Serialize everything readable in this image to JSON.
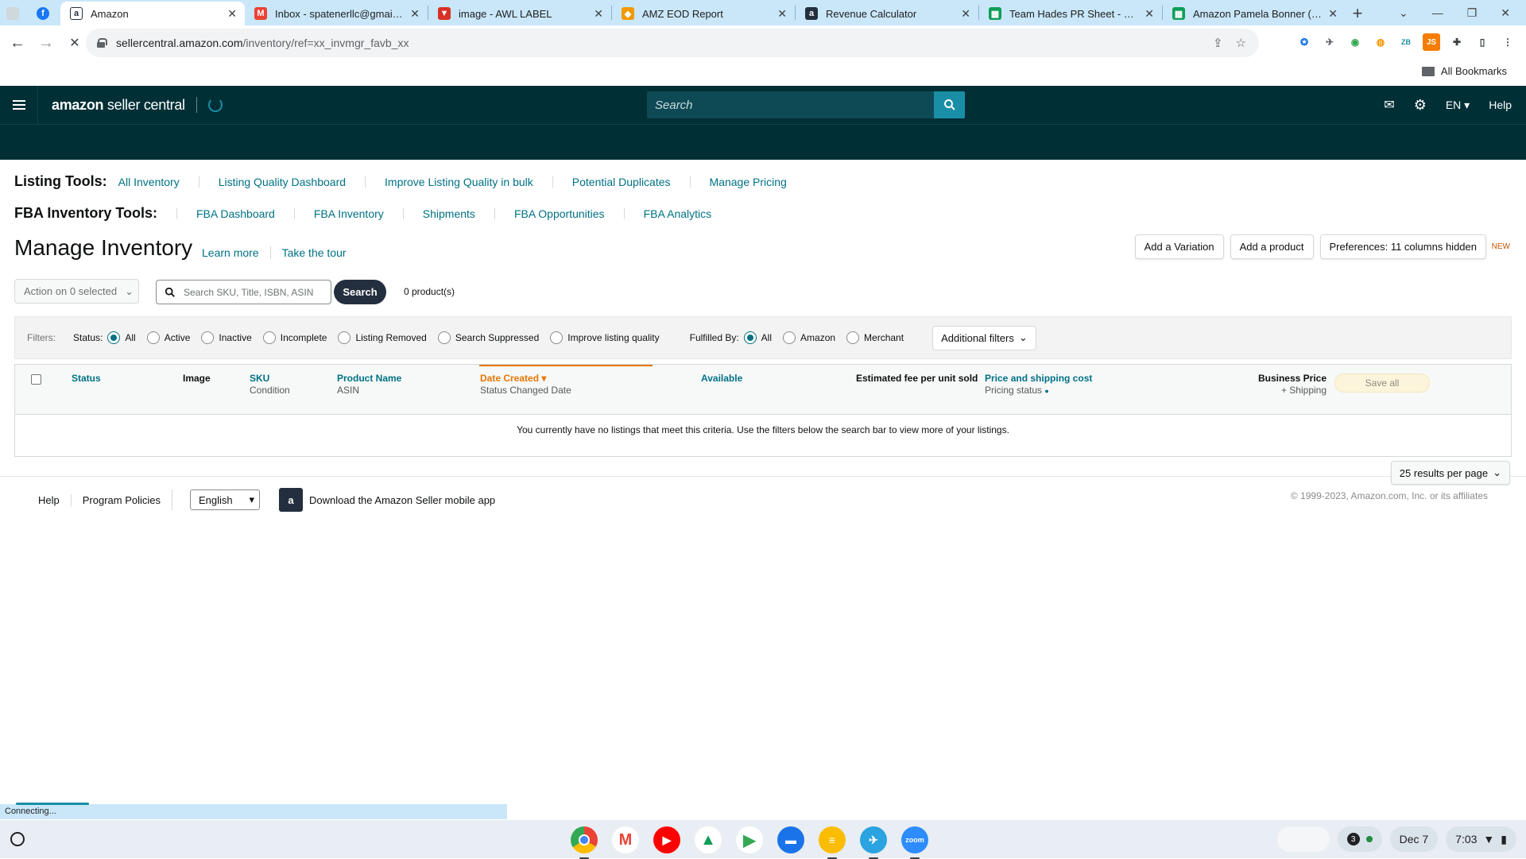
{
  "browser": {
    "tabs": [
      {
        "label": "",
        "icon": "sheets-icon",
        "color": "#cfd8dc"
      },
      {
        "label": "",
        "icon": "facebook-icon",
        "color": "#1877f2"
      },
      {
        "label": "Amazon",
        "icon": "amazon-icon",
        "color": "#232f3e",
        "active": true
      },
      {
        "label": "Inbox - spatenerllc@gmail.com",
        "icon": "gmail-icon",
        "color": "#ea4335"
      },
      {
        "label": "image - AWL LABEL",
        "icon": "label-icon",
        "color": "#d93025"
      },
      {
        "label": "AMZ EOD Report",
        "icon": "report-icon",
        "color": "#f29900"
      },
      {
        "label": "Revenue Calculator",
        "icon": "amazon-icon",
        "color": "#232f3e"
      },
      {
        "label": "Team Hades PR Sheet - Google",
        "icon": "sheets-icon",
        "color": "#0f9d58"
      },
      {
        "label": "Amazon Pamela Bonner (Dr B",
        "icon": "sheets-icon",
        "color": "#0f9d58"
      }
    ],
    "url_host": "sellercentral.amazon.com",
    "url_path": "/inventory/ref=xx_invmgr_favb_xx",
    "bookmarks_label": "All Bookmarks",
    "status_text": "Connecting..."
  },
  "header": {
    "logo_bold": "amazon",
    "logo_rest": " seller central",
    "search_placeholder": "Search",
    "lang": "EN",
    "help": "Help"
  },
  "listing_tools": {
    "label": "Listing Tools:",
    "links": [
      "All Inventory",
      "Listing Quality Dashboard",
      "Improve Listing Quality in bulk",
      "Potential Duplicates",
      "Manage Pricing"
    ]
  },
  "fba_tools": {
    "label": "FBA Inventory Tools:",
    "links": [
      "FBA Dashboard",
      "FBA Inventory",
      "Shipments",
      "FBA Opportunities",
      "FBA Analytics"
    ]
  },
  "page": {
    "title": "Manage Inventory",
    "learn_more": "Learn more",
    "take_tour": "Take the tour",
    "add_variation": "Add a Variation",
    "add_product": "Add a product",
    "preferences": "Preferences: 11 columns hidden",
    "new_badge": "NEW",
    "action_select": "Action on 0 selected",
    "search_placeholder": "Search SKU, Title, ISBN, ASIN",
    "search_button": "Search",
    "product_count": "0 product(s)"
  },
  "filters": {
    "label": "Filters:",
    "status_label": "Status:",
    "status_options": [
      "All",
      "Active",
      "Inactive",
      "Incomplete",
      "Listing Removed",
      "Search Suppressed",
      "Improve listing quality"
    ],
    "status_selected": "All",
    "fulfilled_label": "Fulfilled By:",
    "fulfilled_options": [
      "All",
      "Amazon",
      "Merchant"
    ],
    "fulfilled_selected": "All",
    "additional": "Additional filters"
  },
  "table": {
    "col_status": "Status",
    "col_image": "Image",
    "col_sku": "SKU",
    "col_condition": "Condition",
    "col_product_name": "Product Name",
    "col_asin": "ASIN",
    "col_date_created": "Date Created",
    "col_status_changed": "Status Changed Date",
    "col_available": "Available",
    "col_est_fee": "Estimated fee per unit sold",
    "col_price": "Price and shipping cost",
    "col_pricing_status": "Pricing status",
    "col_business_price": "Business Price",
    "col_plus_shipping": "+ Shipping",
    "save_all": "Save all",
    "empty_message": "You currently have no listings that meet this criteria. Use the filters below the search bar to view more of your listings.",
    "per_page": "25 results per page"
  },
  "footer": {
    "help": "Help",
    "policies": "Program Policies",
    "language": "English",
    "download_app": "Download the Amazon Seller mobile app",
    "copyright": "© 1999-2023, Amazon.com, Inc. or its affiliates"
  },
  "taskbar": {
    "notification_count": "3",
    "date": "Dec 7",
    "time": "7:03"
  }
}
